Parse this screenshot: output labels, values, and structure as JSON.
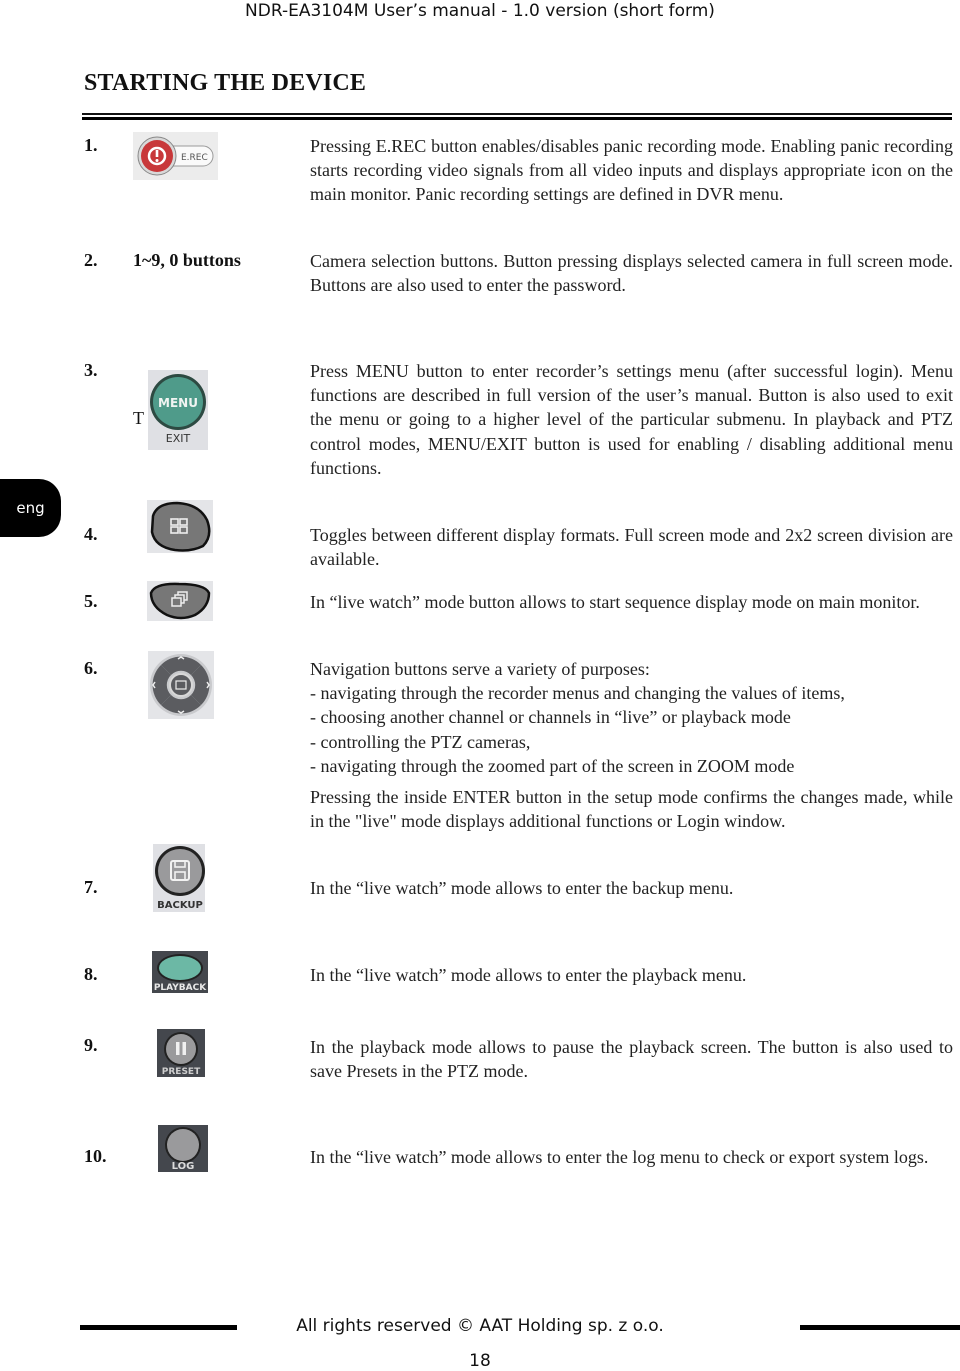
{
  "header": {
    "title": "NDR-EA3104M User’s manual - 1.0 version (short form)"
  },
  "section": {
    "title": "STARTING THE DEVICE"
  },
  "side_tab": {
    "label": "eng"
  },
  "items": [
    {
      "number": "1.",
      "icon": "erec-button-icon",
      "icon_label": "E.REC",
      "text": "Pressing E.REC button enables/disables panic recording mode. Enabling panic recording starts recording video signals from all video inputs and displays appropriate icon on the main monitor. Panic recording settings are defined in DVR menu."
    },
    {
      "number": "2.",
      "label": "1~9, 0 buttons",
      "text": "Camera selection buttons. Button pressing displays selected camera in full screen mode. Buttons are also used to enter the password."
    },
    {
      "number": "3.",
      "icon": "menu-exit-button-icon",
      "icon_label": "MENU",
      "icon_sublabel": "EXIT",
      "stray_text": "T",
      "text": "Press MENU button to enter recorder’s settings menu (after successful login). Menu functions are described in full version of the user’s manual. Button is also used to exit the menu or going to a higher level of the particular submenu. In playback and PTZ control modes, MENU/EXIT button is used for enabling / disabling additional menu functions."
    },
    {
      "number": "4.",
      "icon": "display-format-button-icon",
      "text": "Toggles between different display formats. Full screen mode and 2x2 screen division are available."
    },
    {
      "number": "5.",
      "icon": "sequence-button-icon",
      "text": "In “live watch” mode button allows to start sequence display mode on main monitor."
    },
    {
      "number": "6.",
      "icon": "navigation-pad-icon",
      "intro": "Navigation buttons serve a variety of purposes:",
      "bullets": [
        "-  navigating through the recorder menus and changing the values of  items,",
        "- choosing another channel or channels in “live” or playback mode",
        "-   controlling the PTZ cameras,",
        "- navigating through the zoomed part of the screen in ZOOM mode"
      ],
      "text": "Pressing the inside ENTER button in the setup mode confirms the changes made,  while in the \"live\" mode displays additional functions or Login window."
    },
    {
      "number": "7.",
      "icon": "backup-button-icon",
      "icon_label": "BACKUP",
      "text": "In the “live watch” mode allows to enter the backup menu."
    },
    {
      "number": "8.",
      "icon": "playback-button-icon",
      "icon_label": "PLAYBACK",
      "text": "In the “live watch” mode allows to enter the playback menu."
    },
    {
      "number": "9.",
      "icon": "pause-preset-button-icon",
      "icon_label": "PRESET",
      "text": "In the playback mode allows to pause the playback screen. The button is also used to save Presets in the PTZ mode."
    },
    {
      "number": "10.",
      "icon": "log-button-icon",
      "icon_label": "LOG",
      "text": "In the “live watch” mode allows to enter the log menu to check or export system logs."
    }
  ],
  "footer": {
    "copyright": "All rights reserved © AAT Holding sp. z o.o.",
    "page_number": "18"
  }
}
